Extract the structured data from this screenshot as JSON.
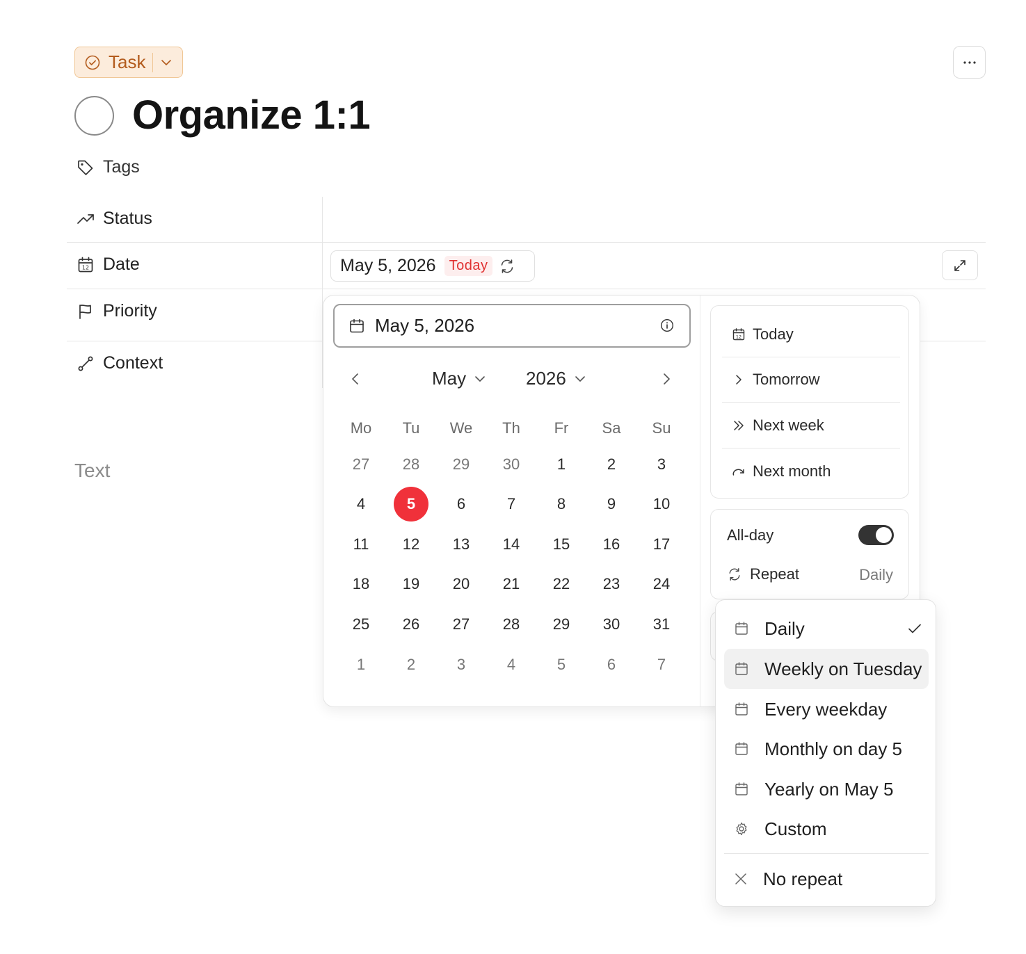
{
  "header": {
    "type_label": "Task",
    "title": "Organize 1:1",
    "tags_label": "Tags"
  },
  "properties": {
    "status_label": "Status",
    "date_label": "Date",
    "priority_label": "Priority",
    "context_label": "Context",
    "date_value": "May 5, 2026",
    "today_badge": "Today"
  },
  "body": {
    "text_placeholder": "Text"
  },
  "calendar": {
    "input_value": "May 5, 2026",
    "month": "May",
    "year": "2026",
    "weekdays": [
      "Mo",
      "Tu",
      "We",
      "Th",
      "Fr",
      "Sa",
      "Su"
    ],
    "weeks": [
      [
        "27",
        "28",
        "29",
        "30",
        "1",
        "2",
        "3"
      ],
      [
        "4",
        "5",
        "6",
        "7",
        "8",
        "9",
        "10"
      ],
      [
        "11",
        "12",
        "13",
        "14",
        "15",
        "16",
        "17"
      ],
      [
        "18",
        "19",
        "20",
        "21",
        "22",
        "23",
        "24"
      ],
      [
        "25",
        "26",
        "27",
        "28",
        "29",
        "30",
        "31"
      ],
      [
        "1",
        "2",
        "3",
        "4",
        "5",
        "6",
        "7"
      ]
    ],
    "selected_day": "5",
    "selected_color": "#f0313a"
  },
  "quick": {
    "today": "Today",
    "tomorrow": "Tomorrow",
    "next_week": "Next week",
    "next_month": "Next month"
  },
  "options": {
    "all_day_label": "All-day",
    "all_day_on": true,
    "repeat_label": "Repeat",
    "repeat_value": "Daily"
  },
  "repeat_menu": {
    "items": [
      {
        "label": "Daily",
        "icon": "calendar-icon",
        "checked": true
      },
      {
        "label": "Weekly on Tuesday",
        "icon": "calendar-icon",
        "highlighted": true
      },
      {
        "label": "Every weekday",
        "icon": "calendar-icon"
      },
      {
        "label": "Monthly on day 5",
        "icon": "calendar-icon"
      },
      {
        "label": "Yearly on May 5",
        "icon": "calendar-icon"
      },
      {
        "label": "Custom",
        "icon": "gear-icon"
      }
    ],
    "no_repeat": "No repeat"
  },
  "colors": {
    "accent_red": "#e03131",
    "task_pill_bg": "#fcecdc",
    "task_pill_text": "#b35b1d"
  }
}
